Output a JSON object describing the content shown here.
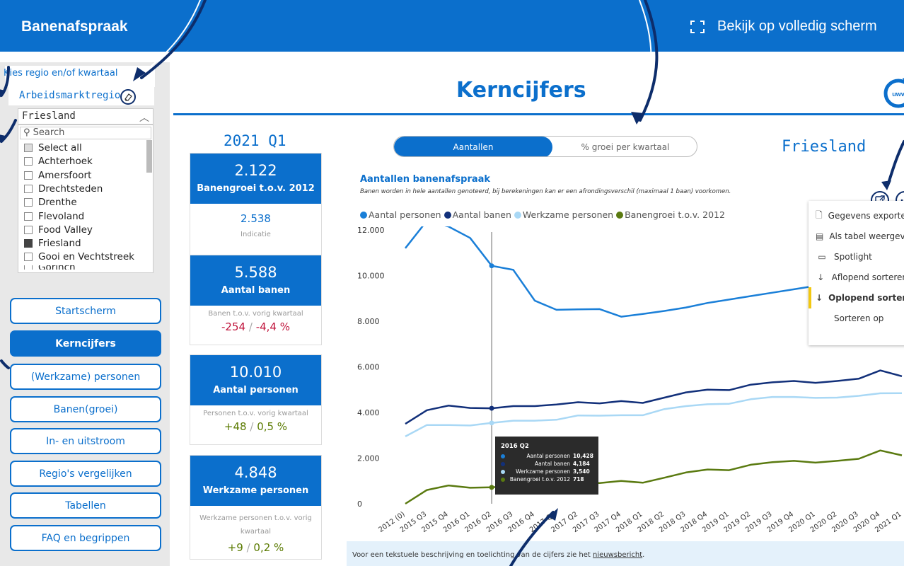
{
  "header": {
    "title": "Banenafspraak",
    "fullscreen_label": "Bekijk op volledig scherm"
  },
  "sidebar": {
    "slicer_title": "Kies regio en/of kwartaal",
    "slicer_field": "Arbeidsmarktregio",
    "dropdown_value": "Friesland",
    "search_placeholder": "Search",
    "options": [
      {
        "label": "Select all",
        "state": "partial"
      },
      {
        "label": "Achterhoek",
        "state": "off"
      },
      {
        "label": "Amersfoort",
        "state": "off"
      },
      {
        "label": "Drechtsteden",
        "state": "off"
      },
      {
        "label": "Drenthe",
        "state": "off"
      },
      {
        "label": "Flevoland",
        "state": "off"
      },
      {
        "label": "Food Valley",
        "state": "off"
      },
      {
        "label": "Friesland",
        "state": "on"
      },
      {
        "label": "Gooi en Vechtstreek",
        "state": "off"
      },
      {
        "label": "Gorinch",
        "state": "off"
      }
    ],
    "nav": [
      "Startscherm",
      "Kerncijfers",
      "(Werkzame) personen",
      "Banen(groei)",
      "In- en uitstroom",
      "Regio's vergelijken",
      "Tabellen",
      "FAQ en begrippen"
    ],
    "active_nav": "Kerncijfers"
  },
  "main": {
    "title": "Kerncijfers",
    "logo_text": "uwv",
    "period": "2021 Q1",
    "region": "Friesland",
    "toggle": {
      "active": "Aantallen",
      "inactive": "% groei per kwartaal"
    },
    "kpis": [
      {
        "value": "2.122",
        "label": "Banengroei t.o.v. 2012",
        "sub": "Indicatie",
        "sub_value": "2.538"
      },
      {
        "value": "5.588",
        "label": "Aantal banen",
        "sub": "Banen t.o.v. vorig kwartaal",
        "delta": "-254",
        "pct": "-4,4 %"
      },
      {
        "value": "10.010",
        "label": "Aantal personen",
        "sub": "Personen t.o.v. vorig kwartaal",
        "delta": "+48",
        "pct": "0,5 %"
      },
      {
        "value": "4.848",
        "label": "Werkzame personen",
        "sub": "Werkzame personen t.o.v. vorig kwartaal",
        "delta": "+9",
        "pct": "0,2 %"
      }
    ],
    "sep": "/",
    "footer_text": "Voor een tekstuele beschrijving en toelichting van de cijfers zie het ",
    "footer_link": "nieuwsbericht",
    "footer_end": "."
  },
  "context_menu": {
    "items": [
      {
        "icon": "export-icon",
        "label": "Gegevens exporteren"
      },
      {
        "icon": "table-icon",
        "label": "Als tabel weergeven"
      },
      {
        "icon": "spotlight-icon",
        "label": "Spotlight"
      },
      {
        "icon": "sort-desc-icon",
        "label": "Aflopend sorteren"
      },
      {
        "icon": "sort-asc-icon",
        "label": "Oplopend sorteren",
        "selected": true
      },
      {
        "icon": "",
        "label": "Sorteren op"
      }
    ]
  },
  "tooltip": {
    "title": "2016 Q2",
    "rows": [
      {
        "label": "Aantal personen",
        "value": "10,428",
        "color": "#1a7fd8"
      },
      {
        "label": "Aantal banen",
        "value": "4,184",
        "color": "#12307a"
      },
      {
        "label": "Werkzame personen",
        "value": "3,540",
        "color": "#a9d8f5"
      },
      {
        "label": "Banengroei t.o.v. 2012",
        "value": "718",
        "color": "#5a7a10"
      }
    ]
  },
  "chart_data": {
    "type": "line",
    "title": "Aantallen banenafspraak",
    "subtitle": "Banen worden in hele aantallen genoteerd, bij berekeningen kan er een afrondingsverschil (maximaal 1 baan) voorkomen.",
    "categories": [
      "2012 (0)",
      "2015 Q3",
      "2015 Q4",
      "2016 Q1",
      "2016 Q2",
      "2016 Q3",
      "2016 Q4",
      "2017 Q1",
      "2017 Q2",
      "2017 Q3",
      "2017 Q4",
      "2018 Q1",
      "2018 Q2",
      "2018 Q3",
      "2018 Q4",
      "2019 Q1",
      "2019 Q2",
      "2019 Q3",
      "2019 Q4",
      "2020 Q1",
      "2020 Q2",
      "2020 Q3",
      "2020 Q4",
      "2021 Q1"
    ],
    "ylim": [
      0,
      12000
    ],
    "yticks": [
      0,
      2000,
      4000,
      6000,
      8000,
      10000,
      12000
    ],
    "ytick_labels": [
      "0",
      "2.000",
      "4.000",
      "6.000",
      "8.000",
      "10.000",
      "12.000"
    ],
    "series": [
      {
        "name": "Aantal personen",
        "color": "#1a7fd8",
        "values": [
          11200,
          12400,
          12150,
          11650,
          10428,
          10250,
          8900,
          8500,
          8520,
          8530,
          8200,
          8320,
          8450,
          8600,
          8800,
          8950,
          9100,
          9250,
          9400,
          9550,
          9700,
          9850,
          9960,
          10010
        ]
      },
      {
        "name": "Aantal banen",
        "color": "#12307a",
        "values": [
          3500,
          4100,
          4300,
          4200,
          4184,
          4280,
          4280,
          4350,
          4450,
          4400,
          4500,
          4420,
          4650,
          4880,
          5000,
          4980,
          5220,
          5320,
          5380,
          5300,
          5380,
          5480,
          5842,
          5588
        ]
      },
      {
        "name": "Werkzame personen",
        "color": "#a9d8f5",
        "values": [
          2950,
          3450,
          3450,
          3430,
          3540,
          3640,
          3640,
          3680,
          3870,
          3860,
          3880,
          3880,
          4150,
          4280,
          4360,
          4380,
          4580,
          4680,
          4680,
          4640,
          4650,
          4730,
          4839,
          4848
        ]
      },
      {
        "name": "Banengroei t.o.v. 2012",
        "color": "#5a7a10",
        "values": [
          0,
          600,
          800,
          700,
          718,
          780,
          780,
          850,
          940,
          910,
          1000,
          920,
          1140,
          1370,
          1500,
          1470,
          1710,
          1820,
          1880,
          1800,
          1880,
          1970,
          2334,
          2122
        ]
      }
    ],
    "highlight_category": "2016 Q2",
    "legend": "top-left",
    "grid": false
  }
}
